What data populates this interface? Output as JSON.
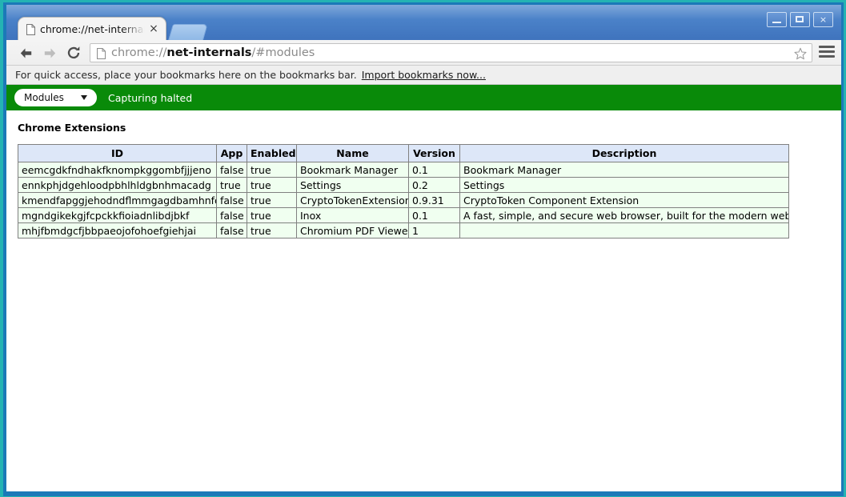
{
  "window": {
    "controls": {
      "minimize_label": "Minimize",
      "maximize_label": "Maximize",
      "close_label": "×"
    }
  },
  "tabs": [
    {
      "title": "chrome://net-internals",
      "close_label": "×",
      "favicon": "page-icon"
    }
  ],
  "new_tab_label": "New tab",
  "toolbar": {
    "back_label": "Back",
    "forward_label": "Forward",
    "reload_label": "Reload",
    "url_scheme": "chrome://",
    "url_host": "net-internals",
    "url_path": "/#modules",
    "url_full": "chrome://net-internals/#modules",
    "star_label": "Bookmark this page",
    "menu_label": "Customize and control"
  },
  "bookmarks_bar": {
    "message": "For quick access, place your bookmarks here on the bookmarks bar.",
    "import_link": "Import bookmarks now..."
  },
  "net_internals": {
    "module_select_value": "Modules",
    "capture_status": "Capturing halted",
    "section_title": "Chrome Extensions",
    "table": {
      "columns": [
        "ID",
        "App",
        "Enabled",
        "Name",
        "Version",
        "Description"
      ],
      "rows": [
        {
          "id": "eemcgdkfndhakfknompkggombfjjjeno",
          "app": "false",
          "enabled": "true",
          "name": "Bookmark Manager",
          "version": "0.1",
          "description": "Bookmark Manager"
        },
        {
          "id": "ennkphjdgehloodpbhlhldgbnhmacadg",
          "app": "true",
          "enabled": "true",
          "name": "Settings",
          "version": "0.2",
          "description": "Settings"
        },
        {
          "id": "kmendfapggjehodndflmmgagdbamhnfd",
          "app": "false",
          "enabled": "true",
          "name": "CryptoTokenExtension",
          "version": "0.9.31",
          "description": "CryptoToken Component Extension"
        },
        {
          "id": "mgndgikekgjfcpckkfioiadnlibdjbkf",
          "app": "false",
          "enabled": "true",
          "name": "Inox",
          "version": "0.1",
          "description": "A fast, simple, and secure web browser, built for the modern web."
        },
        {
          "id": "mhjfbmdgcfjbbpaeojofohoefgiehjai",
          "app": "false",
          "enabled": "true",
          "name": "Chromium PDF Viewer",
          "version": "1",
          "description": ""
        }
      ]
    }
  },
  "colors": {
    "frame_outer": "#24b3b3",
    "titlebar": "#4a81c8",
    "green_bar": "#098a09",
    "table_header": "#dde7f8",
    "table_row": "#f0fff0",
    "table_border": "#808080"
  }
}
